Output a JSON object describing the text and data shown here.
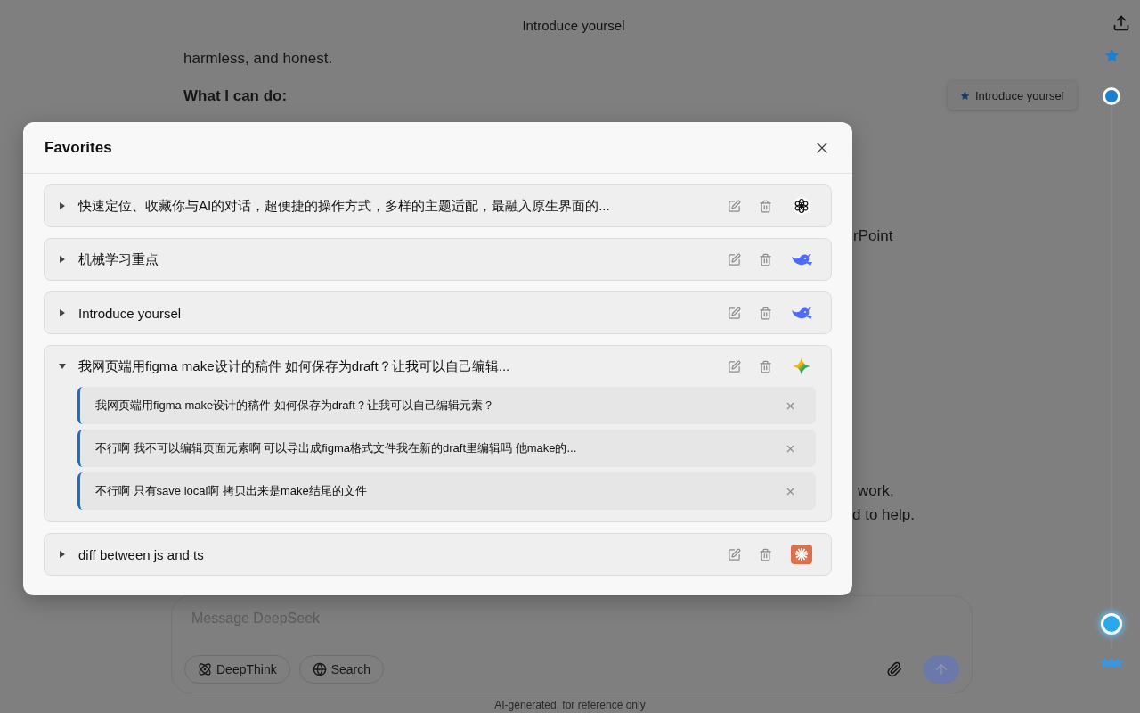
{
  "header": {
    "title": "Introduce yoursel"
  },
  "conversation": {
    "lines": [
      {
        "kind": "text",
        "text": "harmless, and honest."
      },
      {
        "kind": "heading",
        "text": "What I can do:"
      }
    ],
    "fragments": [
      "rPoint",
      "work,",
      "d to help."
    ]
  },
  "timeline": {
    "tooltip": "Introduce yoursel",
    "markers": [
      {
        "kind": "star",
        "selected": false
      },
      {
        "kind": "dot",
        "selected": false
      },
      {
        "kind": "dot",
        "selected": true
      },
      {
        "kind": "stars",
        "selected": false
      }
    ]
  },
  "favorites": {
    "title": "Favorites",
    "items": [
      {
        "title": "快速定位、收藏你与AI的对话，超便捷的操作方式，多样的主题适配，最融入原生界面的...",
        "kind": "chatgpt",
        "expanded": false
      },
      {
        "title": "机械学习重点",
        "kind": "deepseek",
        "expanded": false
      },
      {
        "title": "Introduce yoursel",
        "kind": "deepseek",
        "expanded": false
      },
      {
        "title": "我网页端用figma make设计的稿件 如何保存为draft？让我可以自己编辑...",
        "kind": "gemini",
        "expanded": true,
        "children": [
          "我网页端用figma make设计的稿件 如何保存为draft？让我可以自己编辑元素？",
          "不行啊 我不可以编辑页面元素啊 可以导出成figma格式文件我在新的draft里编辑吗 他make的...",
          "不行啊 只有save local啊 拷贝出来是make结尾的文件"
        ]
      },
      {
        "title": "diff between js and ts",
        "kind": "claude",
        "expanded": false
      }
    ]
  },
  "composer": {
    "placeholder": "Message DeepSeek",
    "toggles": [
      {
        "kind": "think",
        "label": "DeepThink",
        "selected": false
      },
      {
        "kind": "search",
        "label": "Search",
        "selected": false
      }
    ]
  },
  "footer": "AI-generated, for reference only"
}
